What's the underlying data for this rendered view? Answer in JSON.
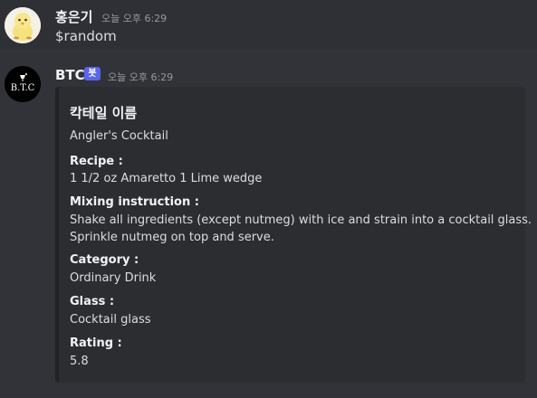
{
  "messages": [
    {
      "username": "홍은기",
      "timestamp": "오늘 오후 6:29",
      "content": "$random"
    },
    {
      "username": "BTC",
      "badge": "봇",
      "timestamp": "오늘 오후 6:29",
      "avatar_text": "B.T.C",
      "embed": {
        "title": "칵테일 이름",
        "description": "Angler's Cocktail",
        "fields": [
          {
            "name": "Recipe :",
            "value": "1 1/2 oz Amaretto 1 Lime wedge"
          },
          {
            "name": "Mixing instruction :",
            "value_line1": "Shake all ingredients (except nutmeg) with ice and strain into a cocktail glass.",
            "value_line2": "Sprinkle nutmeg on top and serve."
          },
          {
            "name": "Category :",
            "value": "Ordinary Drink"
          },
          {
            "name": "Glass :",
            "value": "Cocktail glass"
          },
          {
            "name": "Rating :",
            "value": "5.8"
          }
        ]
      }
    }
  ],
  "colors": {
    "background": "#313338",
    "embed_background": "#2b2d31",
    "bot_badge": "#5865f2"
  }
}
